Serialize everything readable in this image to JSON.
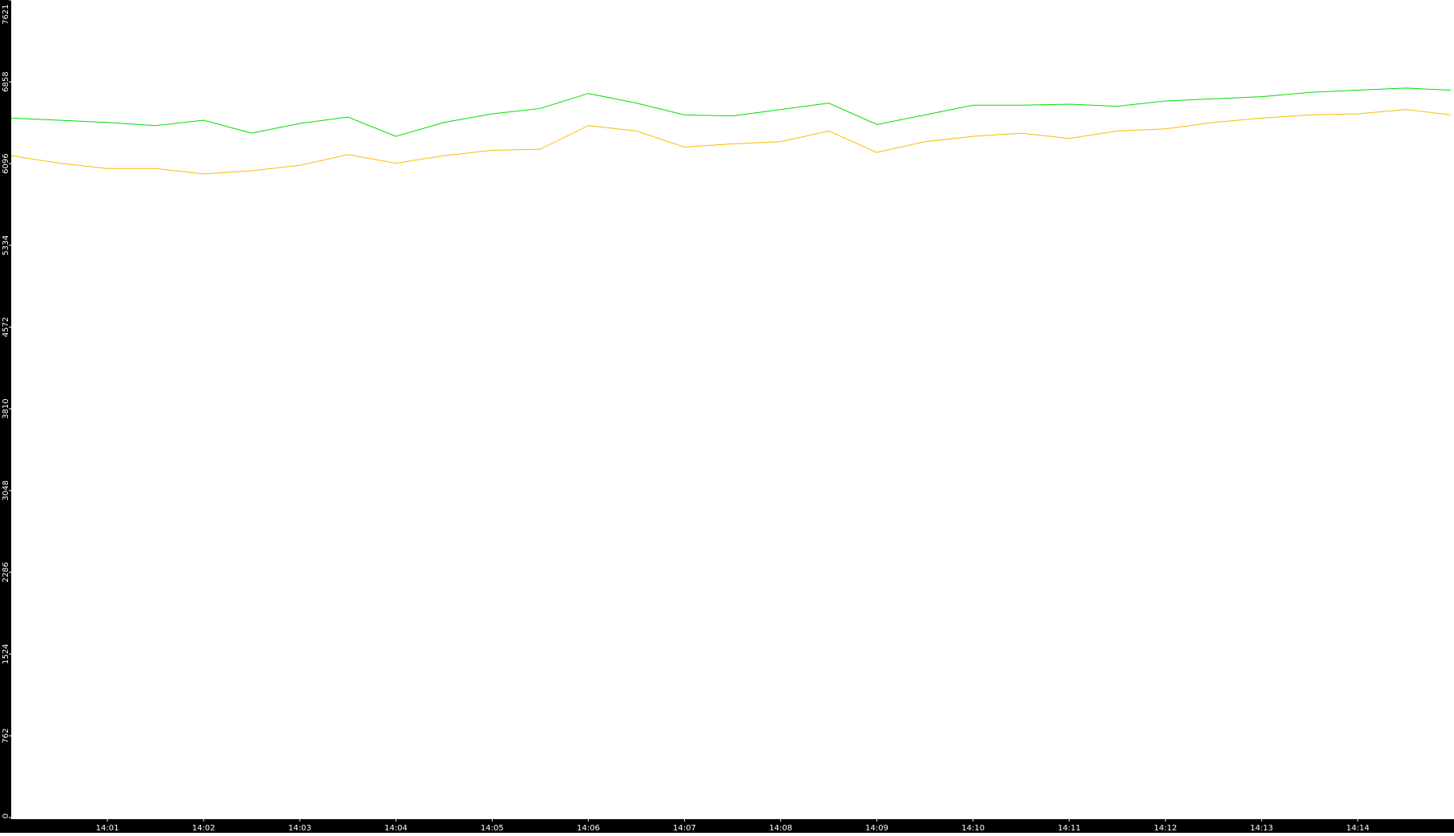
{
  "chart_data": {
    "type": "line",
    "title": "",
    "xlabel": "",
    "ylabel": "",
    "ylim": [
      0,
      7621
    ],
    "xlim": [
      "14:00:00",
      "14:14:58"
    ],
    "grid": false,
    "legend": "none",
    "y_ticks": [
      "0",
      "762",
      "1524",
      "2286",
      "3048",
      "3810",
      "4572",
      "5334",
      "6096",
      "6858",
      "7621"
    ],
    "x_ticks": [
      "14:01",
      "14:02",
      "14:03",
      "14:04",
      "14:05",
      "14:06",
      "14:07",
      "14:08",
      "14:09",
      "14:10",
      "14:11",
      "14:12",
      "14:13",
      "14:14"
    ],
    "x": [
      "14:00:00",
      "14:00:30",
      "14:01:00",
      "14:01:30",
      "14:02:00",
      "14:02:30",
      "14:03:00",
      "14:03:30",
      "14:04:00",
      "14:04:30",
      "14:05:00",
      "14:05:30",
      "14:06:00",
      "14:06:30",
      "14:07:00",
      "14:07:30",
      "14:08:00",
      "14:08:30",
      "14:09:00",
      "14:09:30",
      "14:10:00",
      "14:10:30",
      "14:11:00",
      "14:11:30",
      "14:12:00",
      "14:12:30",
      "14:13:00",
      "14:13:30",
      "14:14:00",
      "14:14:30",
      "14:14:58"
    ],
    "series": [
      {
        "color": "#00dd00",
        "values": [
          6520,
          6500,
          6480,
          6450,
          6500,
          6380,
          6470,
          6530,
          6350,
          6480,
          6560,
          6610,
          6750,
          6660,
          6550,
          6540,
          6600,
          6660,
          6460,
          6550,
          6640,
          6640,
          6650,
          6630,
          6680,
          6700,
          6720,
          6760,
          6780,
          6800,
          6780
        ]
      },
      {
        "color": "#ffbb00",
        "values": [
          6170,
          6100,
          6050,
          6050,
          6000,
          6030,
          6080,
          6180,
          6100,
          6170,
          6220,
          6230,
          6450,
          6400,
          6250,
          6280,
          6300,
          6400,
          6200,
          6300,
          6350,
          6380,
          6330,
          6400,
          6420,
          6480,
          6520,
          6550,
          6560,
          6600,
          6550
        ]
      }
    ]
  },
  "colors": {
    "axis_background": "#000000",
    "plot_background": "#ffffff",
    "tick_text": "#ffffff"
  }
}
